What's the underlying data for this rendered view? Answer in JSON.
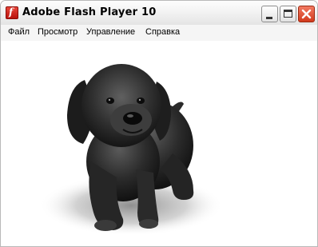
{
  "window": {
    "title": "Adobe Flash Player 10",
    "app_icon": "flash-player-icon",
    "buttons": [
      "minimize-icon",
      "maximize-icon",
      "close-icon"
    ],
    "accent_colors": {
      "close": "#d23a1c",
      "app_icon": "#c41a10"
    }
  },
  "menu": {
    "file": "Файл",
    "view": "Просмотр",
    "control": "Управление",
    "help": "Справка"
  },
  "content": {
    "description_icon": "puppy-image"
  }
}
